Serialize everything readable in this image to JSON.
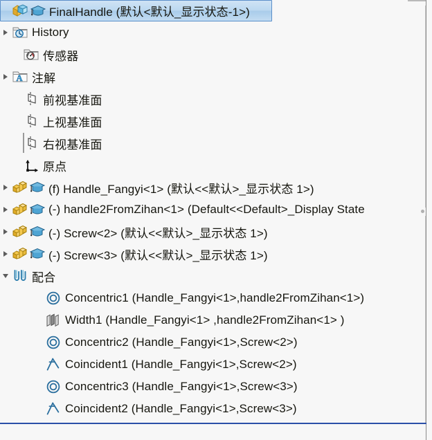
{
  "panel": {
    "name": "solidworks-feature-manager-tree",
    "background_color": "#f7f7f7",
    "selection_color": "#bcd8f0",
    "selection_border_color": "#5b8fc9",
    "bottom_rule_color": "#2a4fa8"
  },
  "tree": {
    "rows": [
      {
        "label": "FinalHandle  (默认<默认_显示状态-1>)",
        "icon": "assembly-icon",
        "secondary_icon": "graduation-cap-icon",
        "indent": 0,
        "twisty": "none",
        "state": "selected",
        "name": "tree-item-final-handle"
      },
      {
        "label": "History",
        "icon": "history-folder-icon",
        "secondary_icon": "none",
        "indent": 0,
        "twisty": "collapsed",
        "state": "normal",
        "name": "tree-item-history"
      },
      {
        "label": "传感器",
        "icon": "sensor-folder-icon",
        "secondary_icon": "none",
        "indent": 1,
        "twisty": "none",
        "state": "normal",
        "name": "tree-item-sensors"
      },
      {
        "label": "注解",
        "icon": "annotations-folder-icon",
        "secondary_icon": "none",
        "indent": 0,
        "twisty": "collapsed",
        "state": "normal",
        "name": "tree-item-annotations"
      },
      {
        "label": "前视基准面",
        "icon": "plane-icon",
        "secondary_icon": "none",
        "indent": 1,
        "twisty": "none",
        "state": "normal",
        "name": "tree-item-front-plane"
      },
      {
        "label": "上视基准面",
        "icon": "plane-icon",
        "secondary_icon": "none",
        "indent": 1,
        "twisty": "none",
        "state": "normal",
        "name": "tree-item-top-plane"
      },
      {
        "label": "右视基准面",
        "icon": "plane-icon",
        "secondary_icon": "none",
        "indent": 1,
        "twisty": "none",
        "state": "focused",
        "name": "tree-item-right-plane"
      },
      {
        "label": "原点",
        "icon": "origin-icon",
        "secondary_icon": "none",
        "indent": 1,
        "twisty": "none",
        "state": "normal",
        "name": "tree-item-origin"
      },
      {
        "label": "(f) Handle_Fangyi<1> (默认<<默认>_显示状态 1>)",
        "icon": "component-icon",
        "secondary_icon": "graduation-cap-icon",
        "indent": 0,
        "twisty": "collapsed",
        "state": "normal",
        "name": "tree-item-component-handle-fangyi"
      },
      {
        "label": "(-) handle2FromZihan<1> (Default<<Default>_Display State",
        "icon": "component-icon",
        "secondary_icon": "graduation-cap-icon",
        "indent": 0,
        "twisty": "collapsed",
        "state": "normal",
        "name": "tree-item-component-handle2-from-zihan"
      },
      {
        "label": "(-) Screw<2> (默认<<默认>_显示状态 1>)",
        "icon": "component-icon",
        "secondary_icon": "graduation-cap-icon",
        "indent": 0,
        "twisty": "collapsed",
        "state": "normal",
        "name": "tree-item-component-screw-2"
      },
      {
        "label": "(-) Screw<3> (默认<<默认>_显示状态 1>)",
        "icon": "component-icon",
        "secondary_icon": "graduation-cap-icon",
        "indent": 0,
        "twisty": "collapsed",
        "state": "normal",
        "name": "tree-item-component-screw-3"
      },
      {
        "label": "配合",
        "icon": "mates-folder-icon",
        "secondary_icon": "none",
        "indent": 0,
        "twisty": "expanded",
        "state": "normal",
        "name": "tree-item-mates-folder"
      },
      {
        "label": "Concentric1 (Handle_Fangyi<1>,handle2FromZihan<1>)",
        "icon": "concentric-icon",
        "secondary_icon": "none",
        "indent": 3,
        "twisty": "none",
        "state": "normal",
        "name": "tree-item-mate-concentric1"
      },
      {
        "label": "Width1 (Handle_Fangyi<1> ,handle2FromZihan<1> )",
        "icon": "width-mate-icon",
        "secondary_icon": "none",
        "indent": 3,
        "twisty": "none",
        "state": "normal",
        "name": "tree-item-mate-width1"
      },
      {
        "label": "Concentric2 (Handle_Fangyi<1>,Screw<2>)",
        "icon": "concentric-icon",
        "secondary_icon": "none",
        "indent": 3,
        "twisty": "none",
        "state": "normal",
        "name": "tree-item-mate-concentric2"
      },
      {
        "label": "Coincident1 (Handle_Fangyi<1>,Screw<2>)",
        "icon": "coincident-icon",
        "secondary_icon": "none",
        "indent": 3,
        "twisty": "none",
        "state": "normal",
        "name": "tree-item-mate-coincident1"
      },
      {
        "label": "Concentric3 (Handle_Fangyi<1>,Screw<3>)",
        "icon": "concentric-icon",
        "secondary_icon": "none",
        "indent": 3,
        "twisty": "none",
        "state": "normal",
        "name": "tree-item-mate-concentric3"
      },
      {
        "label": "Coincident2 (Handle_Fangyi<1>,Screw<3>)",
        "icon": "coincident-icon",
        "secondary_icon": "none",
        "indent": 3,
        "twisty": "none",
        "state": "normal",
        "name": "tree-item-mate-coincident2"
      }
    ]
  }
}
